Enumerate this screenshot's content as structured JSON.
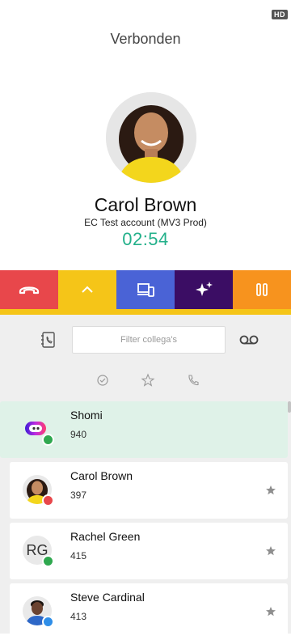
{
  "header": {
    "hd_badge": "HD",
    "status": "Verbonden"
  },
  "caller": {
    "name": "Carol Brown",
    "account": "EC Test account (MV3 Prod)",
    "timer": "02:54"
  },
  "actions": [
    {
      "name": "hangup-button",
      "icon": "hangup-icon",
      "color": "#e8474b"
    },
    {
      "name": "expand-button",
      "icon": "chevron-up-icon",
      "color": "#f5c518"
    },
    {
      "name": "transfer-device-button",
      "icon": "devices-icon",
      "color": "#4a63d6"
    },
    {
      "name": "ai-button",
      "icon": "sparkle-icon",
      "color": "#3b0d64"
    },
    {
      "name": "hold-button",
      "icon": "pause-icon",
      "color": "#f7931e"
    }
  ],
  "filter": {
    "placeholder": "Filter collega's"
  },
  "contacts": [
    {
      "name": "Shomi",
      "ext": "940",
      "status_color": "#2fa84f",
      "avatar": "shomi-logo",
      "active": true
    },
    {
      "name": "Carol Brown",
      "ext": "397",
      "status_color": "#e8474b",
      "avatar": "photo"
    },
    {
      "name": "Rachel Green",
      "ext": "415",
      "status_color": "#2fa84f",
      "avatar": "initials",
      "initials": "RG"
    },
    {
      "name": "Steve Cardinal",
      "ext": "413",
      "status_color": "#2f8ee8",
      "avatar": "photo"
    }
  ],
  "colors": {
    "accent": "#23b08a",
    "strip": "#f5c518"
  }
}
